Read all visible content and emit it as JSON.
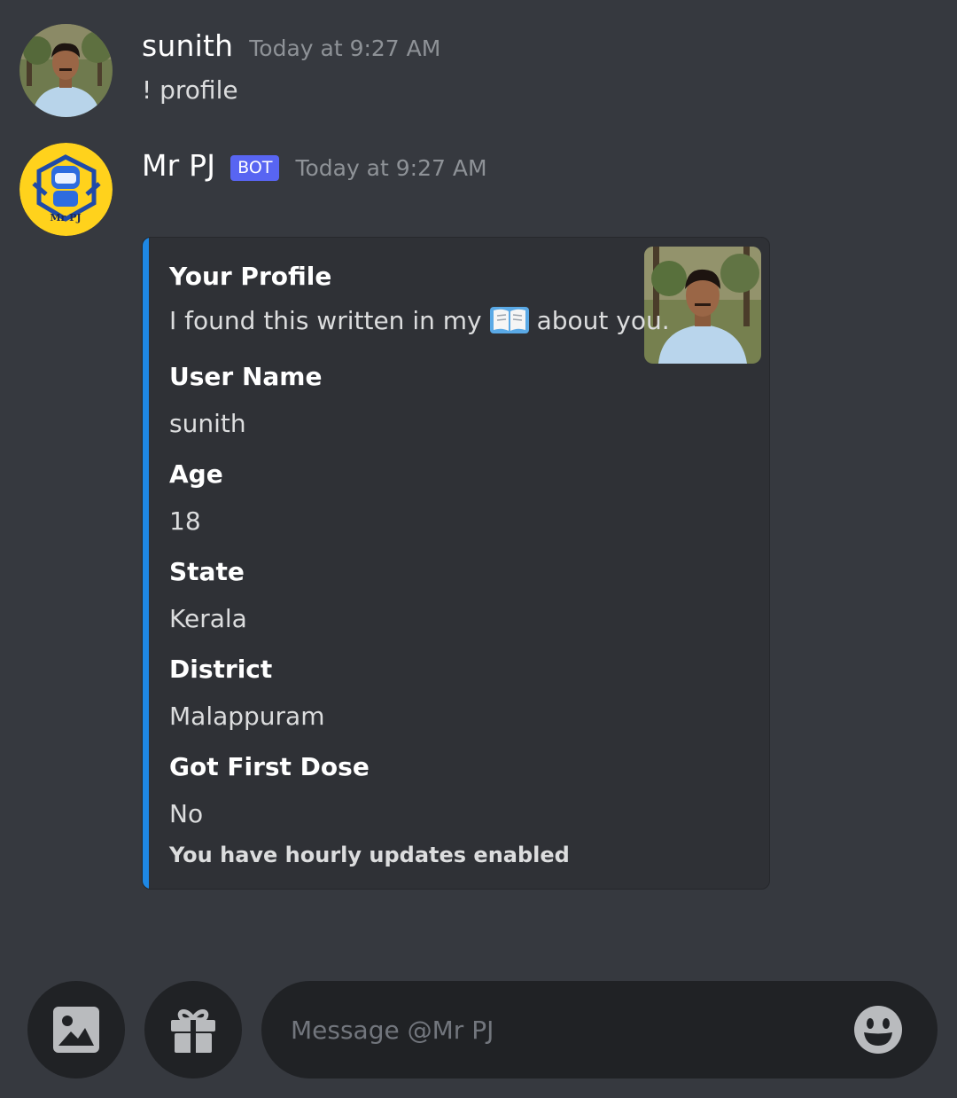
{
  "messages": [
    {
      "username": "sunith",
      "timestamp": "Today at 9:27 AM",
      "text": "! profile"
    },
    {
      "username": "Mr PJ",
      "badge": "BOT",
      "timestamp": "Today at 9:27 AM",
      "avatar_text": "Mr PJ"
    }
  ],
  "embed": {
    "accent_color": "#1e88e5",
    "title": "Your Profile",
    "description_before": "I found this written in my",
    "description_icon": "open-book-icon",
    "description_after": "about you.",
    "fields": [
      {
        "name": "User Name",
        "value": "sunith"
      },
      {
        "name": "Age",
        "value": "18"
      },
      {
        "name": "State",
        "value": "Kerala"
      },
      {
        "name": "District",
        "value": "Malappuram"
      },
      {
        "name": "Got First Dose",
        "value": "No"
      }
    ],
    "footer": "You have hourly updates enabled"
  },
  "composer": {
    "attach_icon": "image-icon",
    "gift_icon": "gift-icon",
    "placeholder": "Message @Mr PJ",
    "emoji_icon": "emoji-icon"
  },
  "colors": {
    "background": "#36393f",
    "embed_background": "#2f3136",
    "bot_badge": "#5865f2",
    "input_background": "#202225"
  }
}
